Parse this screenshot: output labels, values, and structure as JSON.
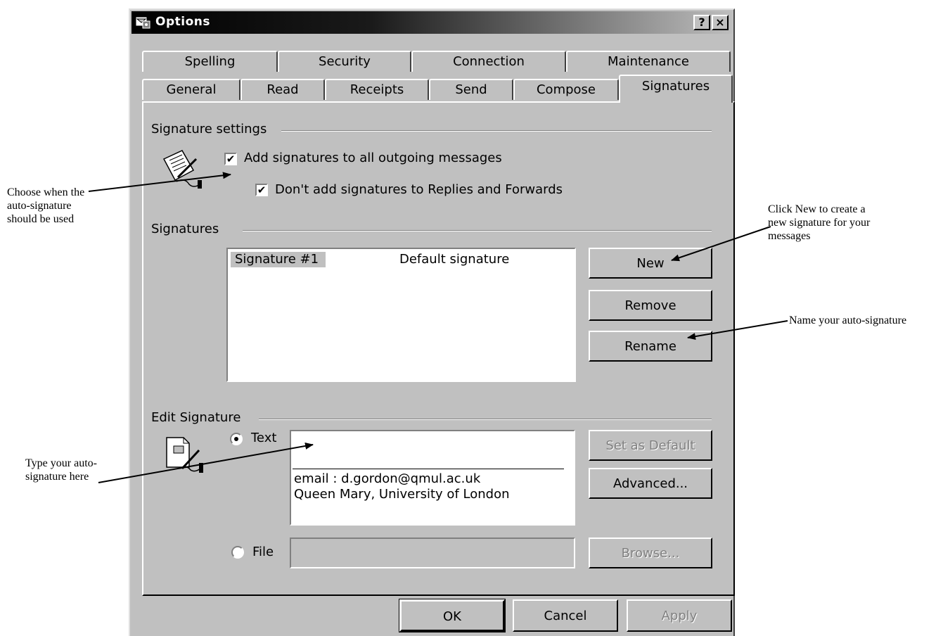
{
  "annotations": {
    "when": [
      "Choose when the",
      "auto-signature",
      "should be used"
    ],
    "new": [
      "Click New to create a",
      "new signature for your",
      "messages"
    ],
    "name": "Name your auto-signature",
    "type": [
      "Type your auto-",
      "signature here"
    ]
  },
  "window": {
    "title": "Options",
    "help_button": "?",
    "close_button": "×"
  },
  "tabs_row1": [
    "Spelling",
    "Security",
    "Connection",
    "Maintenance"
  ],
  "tabs_row2": [
    "General",
    "Read",
    "Receipts",
    "Send",
    "Compose",
    "Signatures"
  ],
  "active_tab": "Signatures",
  "signature_settings": {
    "group_label": "Signature settings",
    "add_to_all": {
      "label": "Add signatures to all outgoing messages",
      "checked": true
    },
    "no_replies": {
      "label": "Don't add signatures to Replies and Forwards",
      "checked": true
    }
  },
  "signatures": {
    "group_label": "Signatures",
    "list": [
      {
        "name": "Signature #1",
        "description": "Default signature",
        "selected": true
      }
    ],
    "buttons": {
      "new": "New",
      "remove": "Remove",
      "rename": "Rename"
    }
  },
  "edit_signature": {
    "group_label": "Edit Signature",
    "text_option": {
      "label": "Text",
      "selected": true
    },
    "text_lines": [
      "email : d.gordon@qmul.ac.uk",
      "Queen Mary, University of London"
    ],
    "file_option": {
      "label": "File",
      "selected": false
    },
    "file_value": "",
    "buttons": {
      "set_default": "Set as Default",
      "advanced": "Advanced...",
      "browse": "Browse..."
    }
  },
  "footer": {
    "ok": "OK",
    "cancel": "Cancel",
    "apply": "Apply"
  },
  "icons": {
    "title": "options-app-icon",
    "settings": "signature-pen-icon",
    "edit": "document-pen-icon"
  }
}
